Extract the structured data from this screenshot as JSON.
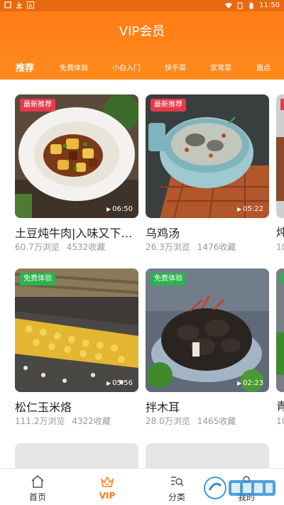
{
  "status_bar": {
    "time": "11:50",
    "icons": [
      "notification-square-icon",
      "download-icon",
      "font-a-icon",
      "wifi-icon",
      "sim-icon",
      "battery-icon"
    ]
  },
  "header": {
    "title": "VIP会员",
    "tabs": [
      {
        "label": "推荐",
        "active": true
      },
      {
        "label": "免费体验",
        "active": false
      },
      {
        "label": "小白入门",
        "active": false
      },
      {
        "label": "快手菜",
        "active": false
      },
      {
        "label": "家常菜",
        "active": false
      },
      {
        "label": "面点",
        "active": false
      }
    ]
  },
  "cards": [
    {
      "badge": "最新推荐",
      "badge_color": "#e53a4c",
      "duration": "06:50",
      "title": "土豆炖牛肉|入味又下…",
      "views": "60.7万浏览",
      "favorites": "4532收藏"
    },
    {
      "badge": "最新推荐",
      "badge_color": "#e53a4c",
      "duration": "05:22",
      "title": "乌鸡汤",
      "views": "26.3万浏览",
      "favorites": "1476收藏"
    },
    {
      "badge": "免费体验",
      "badge_color": "#2bb34d",
      "duration": "05:56",
      "title": "松仁玉米烙",
      "views": "111.2万浏览",
      "favorites": "4322收藏"
    },
    {
      "badge": "免费体验",
      "badge_color": "#2bb34d",
      "duration": "02:23",
      "title": "拌木耳",
      "views": "28.0万浏览",
      "favorites": "1465收藏"
    }
  ],
  "peek": {
    "row1_title": "炖",
    "row1_stats": "10",
    "row2_title": "青",
    "row2_stats": "10"
  },
  "bottom_nav": [
    {
      "label": "首页",
      "icon": "home-icon",
      "active": false
    },
    {
      "label": "VIP",
      "icon": "crown-icon",
      "active": true
    },
    {
      "label": "分类",
      "icon": "category-search-icon",
      "active": false
    },
    {
      "label": "我的",
      "icon": "profile-icon",
      "active": false
    }
  ],
  "accent_color": "#ff7a14"
}
